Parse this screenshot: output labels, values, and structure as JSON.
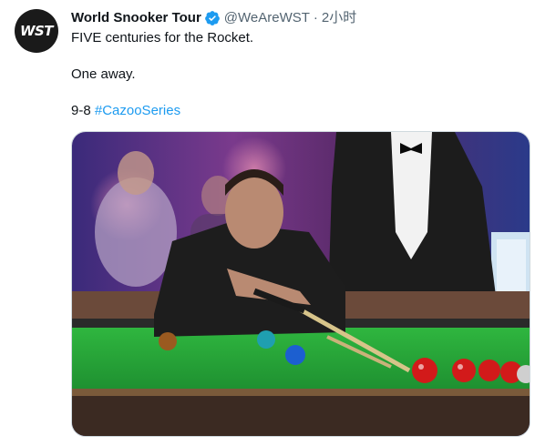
{
  "tweet": {
    "author": {
      "display_name": "World Snooker Tour",
      "handle": "@WeAreWST",
      "avatar_text": "WST",
      "verified": true
    },
    "separator": "·",
    "timestamp": "2小时",
    "text_line1": "FIVE centuries for the Rocket.",
    "text_line2": "One away.",
    "score": "9-8",
    "hashtag": "#CazooSeries",
    "media": {
      "alt": "photo",
      "icon": "photo-icon"
    }
  },
  "colors": {
    "text_primary": "#0f1419",
    "text_secondary": "#536471",
    "link": "#1d9bf0",
    "verified": "#1d9bf0",
    "table_green": "#23a336"
  }
}
